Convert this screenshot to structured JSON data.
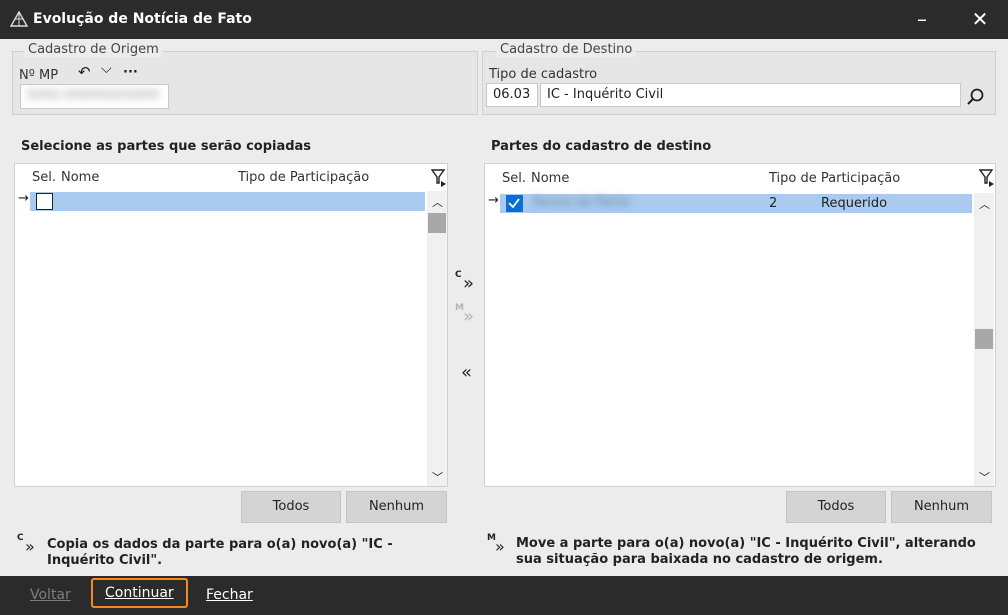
{
  "window": {
    "title": "Evolução de Notícia de Fato",
    "minimize_glyph": "–",
    "close_glyph": "✕"
  },
  "origem": {
    "legend": "Cadastro de Origem",
    "mp_label": "Nº MP",
    "mp_value": "0000.0000000/0000",
    "undo_glyph": "↶",
    "chevron_glyph": "⌵",
    "more_glyph": "···"
  },
  "destino": {
    "legend": "Cadastro de Destino",
    "tipo_label": "Tipo de cadastro",
    "tipo_code": "06.03",
    "tipo_desc": "IC - Inquérito Civil"
  },
  "left_panel": {
    "title": "Selecione as partes que serão copiadas",
    "columns": [
      "Sel.",
      "Nome",
      "Tipo de Participação"
    ],
    "rows": [
      {
        "checked": false,
        "nome": "",
        "tipo": ""
      }
    ],
    "todos_label": "Todos",
    "nenhum_label": "Nenhum"
  },
  "right_panel": {
    "title": "Partes do cadastro de destino",
    "columns": [
      "Sel.",
      "Nome",
      "Tipo de Participação"
    ],
    "rows": [
      {
        "checked": true,
        "nome": "Nome da Parte",
        "codigo": "2",
        "tipo": "Requerido"
      }
    ],
    "todos_label": "Todos",
    "nenhum_label": "Nenhum"
  },
  "transfer": {
    "copy_letter": "C",
    "move_letter": "M",
    "arrow_right": "»",
    "arrow_left": "«"
  },
  "notes": {
    "copy_letter": "C",
    "copy_text": "Copia os dados da parte para o(a) novo(a) \"IC - Inquérito Civil\".",
    "move_letter": "M",
    "move_text": "Move a parte para o(a) novo(a) \"IC - Inquérito Civil\", alterando sua situação para baixada no cadastro de origem."
  },
  "footer": {
    "voltar": "Voltar",
    "continuar": "Continuar",
    "fechar": "Fechar"
  },
  "colors": {
    "titlebar": "#2b2b2b",
    "selected_row": "#a9cbef",
    "check_blue": "#0a6fd1",
    "focus_orange": "#f08a24"
  }
}
